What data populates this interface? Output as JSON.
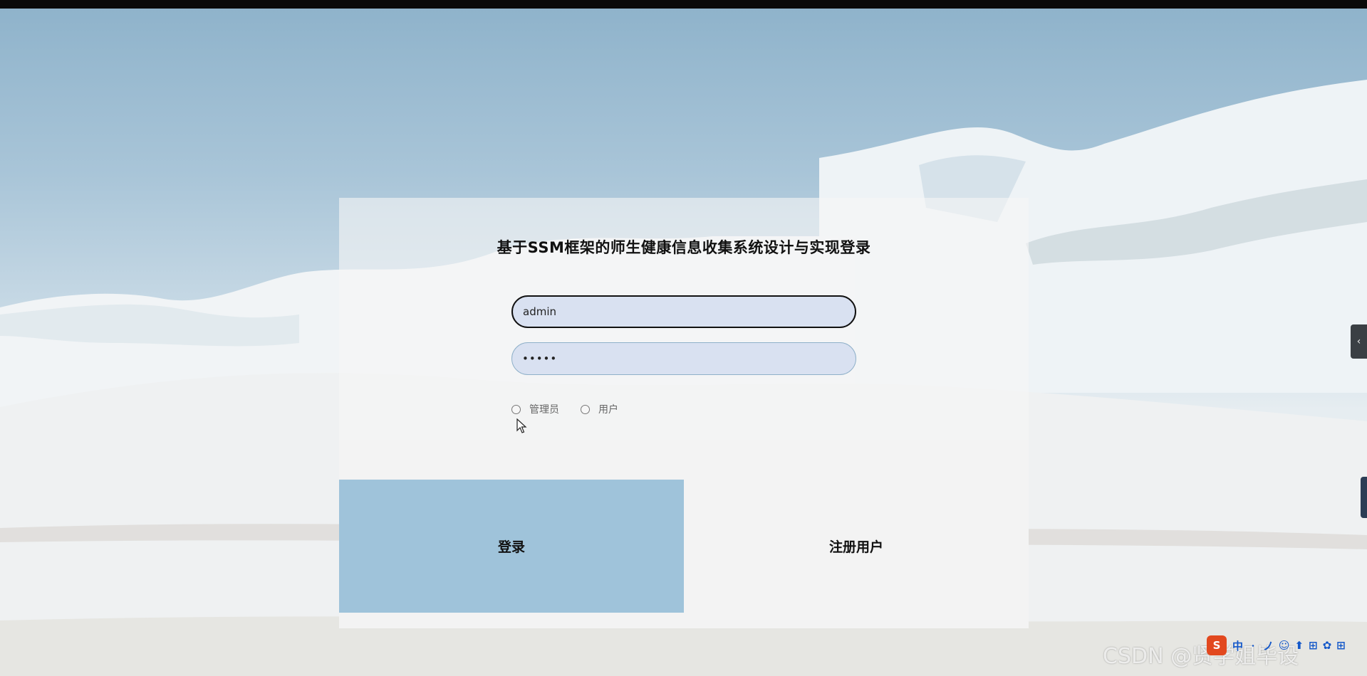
{
  "page": {
    "title": "基于SSM框架的师生健康信息收集系统设计与实现登录"
  },
  "login_form": {
    "username_value": "admin",
    "password_value": "•••••",
    "roles": [
      {
        "label": "管理员",
        "selected": false
      },
      {
        "label": "用户",
        "selected": false
      }
    ],
    "login_button": "登录",
    "register_button": "注册用户"
  },
  "overlay": {
    "side_tab_icon": "‹",
    "watermark": "CSDN @贤学姐毕设"
  },
  "ime_toolbar": {
    "logo": "S",
    "items": [
      "中",
      "ㆍ",
      "ノ",
      "☺",
      "⬆",
      "⊞",
      "✿",
      "⊞"
    ]
  },
  "theme": {
    "login_button_color": "#9fc3da",
    "field_background": "#d9e1f1",
    "ime_logo_color": "#e2481e"
  }
}
